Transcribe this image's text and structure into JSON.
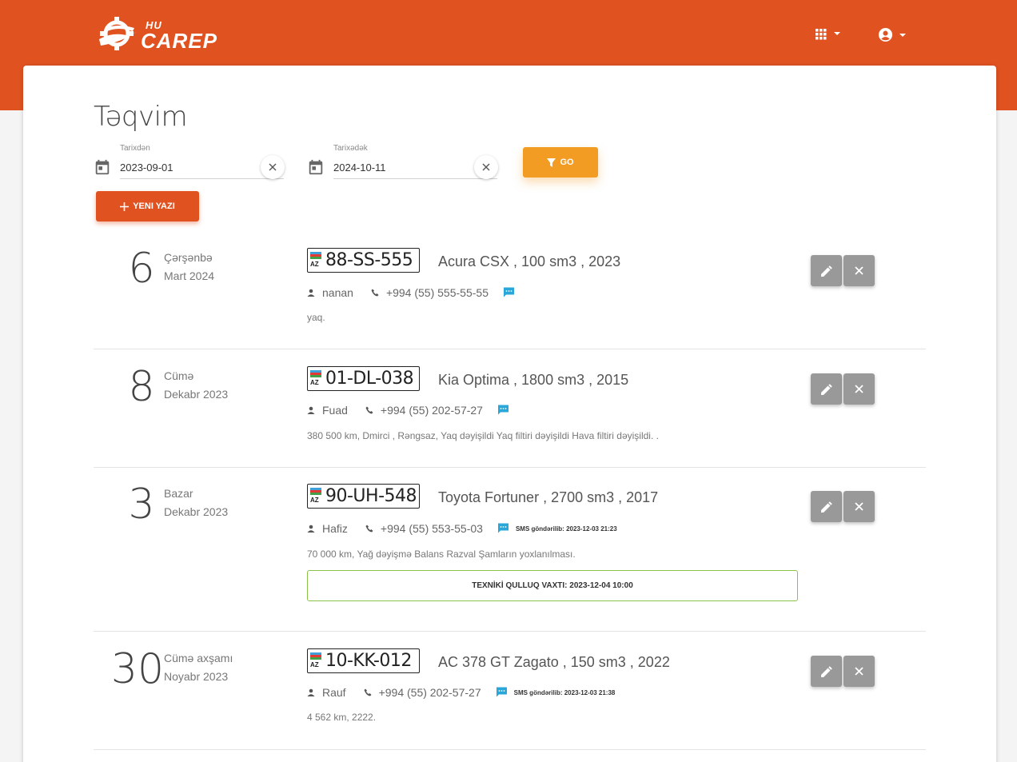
{
  "brand": {
    "small": "HU",
    "big": "CAREP"
  },
  "header": {
    "apps_icon": "apps-grid-icon",
    "user_icon": "account-circle-icon"
  },
  "page": {
    "title": "Təqvim"
  },
  "filters": {
    "from_label": "Tarixdən",
    "from_value": "2023-09-01",
    "to_label": "Tarixədək",
    "to_value": "2024-10-11",
    "go_label": "GO",
    "new_label": "YENI YAZI"
  },
  "entries": [
    {
      "day": "6",
      "weekday": "Çərşənbə",
      "month": "Mart 2024",
      "plate": "88-SS-555",
      "plate_country": "AZ",
      "car": "Acura CSX , 100 sm3 , 2023",
      "owner": "nanan",
      "phone": "+994 (55) 555-55-55",
      "sms": "",
      "note": "yaq.",
      "service": ""
    },
    {
      "day": "8",
      "weekday": "Cümə",
      "month": "Dekabr 2023",
      "plate": "01-DL-038",
      "plate_country": "AZ",
      "car": "Kia Optima , 1800 sm3 , 2015",
      "owner": "Fuad",
      "phone": "+994 (55) 202-57-27",
      "sms": "",
      "note": "380 500 km, Dmirci , Rəngsaz, Yaq dəyişildi Yaq filtiri dəyişildi Hava filtiri dəyişildi. .",
      "service": ""
    },
    {
      "day": "3",
      "weekday": "Bazar",
      "month": "Dekabr 2023",
      "plate": "90-UH-548",
      "plate_country": "AZ",
      "car": "Toyota Fortuner , 2700 sm3 , 2017",
      "owner": "Hafiz",
      "phone": "+994 (55) 553-55-03",
      "sms": "SMS göndərilib: 2023-12-03 21:23",
      "note": "70 000 km, Yağ dəyişmə Balans Razval Şamların yoxlanılması.",
      "service": "TEXNİKİ QULLUQ VAXTI: 2023-12-04 10:00"
    },
    {
      "day": "30",
      "weekday": "Cümə axşamı",
      "month": "Noyabr 2023",
      "plate": "10-KK-012",
      "plate_country": "AZ",
      "car": "AC 378 GT Zagato , 150 sm3 , 2022",
      "owner": "Rauf",
      "phone": "+994 (55) 202-57-27",
      "sms": "SMS göndərilib: 2023-12-03 21:38",
      "note": "4 562 km, 2222.",
      "service": ""
    }
  ],
  "colors": {
    "brand": "#e15221",
    "accent": "#f39c24",
    "action": "#999999",
    "success_border": "#8bc34a",
    "sms_icon": "#29a7d9"
  }
}
